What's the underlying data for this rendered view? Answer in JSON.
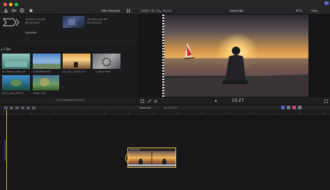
{
  "toolbar": {
    "library_name": "Vide Importat",
    "format": "1080p HD 25p, Stereo",
    "project_title": "Subscribe",
    "zoom": "87%",
    "view_label": "View"
  },
  "import_items": [
    {
      "title": "10/2021 4:05 PM",
      "meta": "00:00:00:00"
    },
    {
      "title": "Subscribe",
      "meta": ""
    }
  ],
  "browser": {
    "section_label": "Clips",
    "status": "1 of 6 selected, 00:15:27",
    "clips": [
      {
        "name": "AG_Black_Guitar_Gr"
      },
      {
        "name": "CostalBeachAb"
      },
      {
        "name": "AG_Clip_Sunset_On"
      },
      {
        "name": "Cycling Road"
      },
      {
        "name": "Aerial_San_Dark_2"
      },
      {
        "name": "Vistas_Clip"
      }
    ]
  },
  "viewer": {
    "timecode": "15:27",
    "title": "Subscribe",
    "playhead_fraction": 0.62
  },
  "timeline": {
    "title": "Subscribe",
    "timecode": "00:00:15:27",
    "clip_title": "Subscribe"
  },
  "colors": {
    "accent": "#4b6bd6",
    "playhead": "#d9b23a",
    "clip_selection": "#e3c24d"
  },
  "icons": [
    "close-icon",
    "minimize-icon",
    "zoom-icon",
    "import-icon",
    "key-icon",
    "checkmark-icon",
    "star-icon",
    "play-icon",
    "magic-wand-icon",
    "settings-icon",
    "grid-icon"
  ]
}
